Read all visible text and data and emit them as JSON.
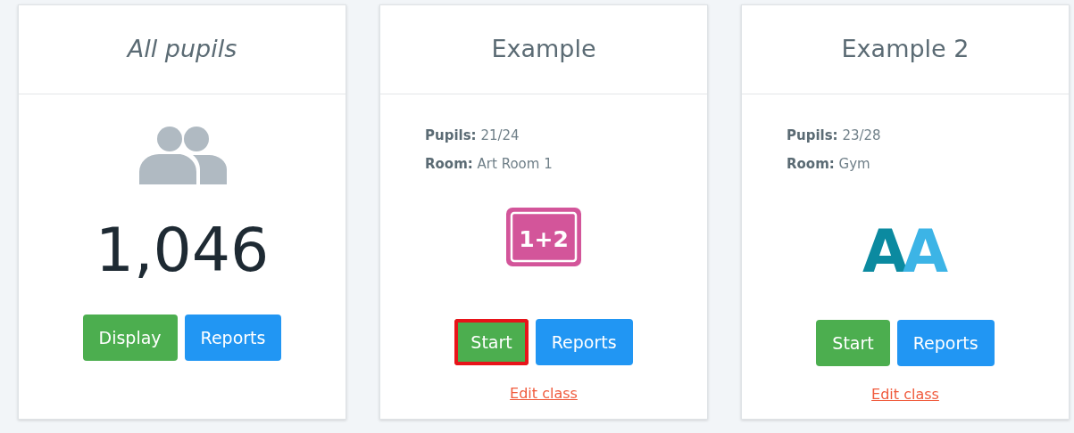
{
  "cards": [
    {
      "kind": "summary",
      "title": "All pupils",
      "title_italic": true,
      "count": "1,046",
      "buttons": [
        {
          "label": "Display",
          "kind": "success",
          "highlighted": false
        },
        {
          "label": "Reports",
          "kind": "primary",
          "highlighted": false
        }
      ]
    },
    {
      "kind": "class",
      "title": "Example",
      "title_italic": false,
      "info": [
        "**Pupils:** 21/24",
        "**Room:** Art Room 1"
      ],
      "icon": {
        "kind": "tile",
        "text": "1+2"
      },
      "buttons": [
        {
          "label": "Start",
          "kind": "success",
          "highlighted": true
        },
        {
          "label": "Reports",
          "kind": "primary",
          "highlighted": false
        }
      ],
      "link": "Edit class"
    },
    {
      "kind": "class",
      "title": "Example 2",
      "title_italic": false,
      "info": [
        "**Pupils:** 23/28",
        "**Room:** Gym"
      ],
      "icon": {
        "kind": "letters",
        "text": "AA"
      },
      "buttons": [
        {
          "label": "Start",
          "kind": "success",
          "highlighted": false
        },
        {
          "label": "Reports",
          "kind": "primary",
          "highlighted": false
        }
      ],
      "link": "Edit class"
    }
  ]
}
